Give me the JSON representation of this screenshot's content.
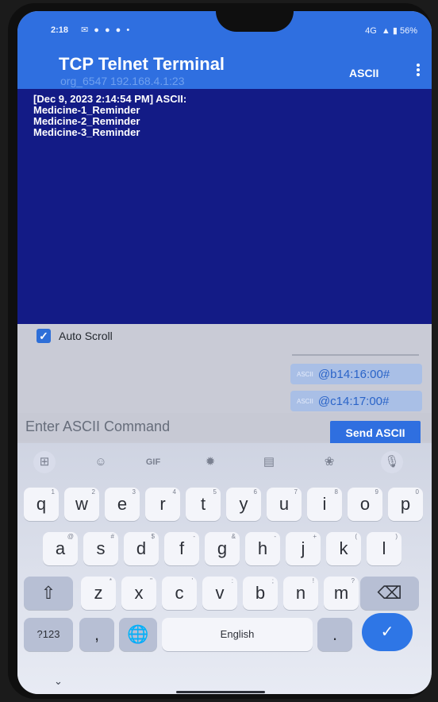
{
  "status_bar": {
    "time": "2:18",
    "notification_icons": [
      "message-icon",
      "person-icon",
      "person-icon",
      "person-icon",
      "dot-icon"
    ],
    "network": "4G",
    "battery": "56%"
  },
  "app_bar": {
    "title": "TCP Telnet Terminal",
    "subtitle": "org_6547 192.168.4.1:23",
    "mode_label": "ASCII",
    "more_icon": "more-vert-icon"
  },
  "terminal": {
    "lines": [
      "[Dec 9, 2023 2:14:54 PM] ASCII:",
      "Medicine-1_Reminder",
      "Medicine-2_Reminder",
      "Medicine-3_Reminder"
    ]
  },
  "controls": {
    "auto_scroll_label": "Auto Scroll",
    "auto_scroll_checked": true
  },
  "history": [
    {
      "prefix": "ASCII",
      "value": "@b14:16:00#"
    },
    {
      "prefix": "ASCII",
      "value": "@c14:17:00#"
    }
  ],
  "input": {
    "placeholder": "Enter ASCII Command",
    "value": "",
    "send_label": "Send ASCII"
  },
  "keyboard": {
    "toolbar": [
      "apps-icon",
      "sticker-icon",
      "GIF",
      "settings-icon",
      "translate-icon",
      "palette-icon",
      "mic-icon"
    ],
    "row1": [
      {
        "key": "q",
        "hint": "1"
      },
      {
        "key": "w",
        "hint": "2"
      },
      {
        "key": "e",
        "hint": "3"
      },
      {
        "key": "r",
        "hint": "4"
      },
      {
        "key": "t",
        "hint": "5"
      },
      {
        "key": "y",
        "hint": "6"
      },
      {
        "key": "u",
        "hint": "7"
      },
      {
        "key": "i",
        "hint": "8"
      },
      {
        "key": "o",
        "hint": "9"
      },
      {
        "key": "p",
        "hint": "0"
      }
    ],
    "row2": [
      {
        "key": "a",
        "hint": "@"
      },
      {
        "key": "s",
        "hint": "#"
      },
      {
        "key": "d",
        "hint": "$"
      },
      {
        "key": "f",
        "hint": "-"
      },
      {
        "key": "g",
        "hint": "&"
      },
      {
        "key": "h",
        "hint": "-"
      },
      {
        "key": "j",
        "hint": "+"
      },
      {
        "key": "k",
        "hint": "("
      },
      {
        "key": "l",
        "hint": ")"
      }
    ],
    "row3": [
      {
        "key": "z",
        "hint": "*"
      },
      {
        "key": "x",
        "hint": "\""
      },
      {
        "key": "c",
        "hint": "'"
      },
      {
        "key": "v",
        "hint": ":"
      },
      {
        "key": "b",
        "hint": ";"
      },
      {
        "key": "n",
        "hint": "!"
      },
      {
        "key": "m",
        "hint": "?"
      }
    ],
    "symbols_label": "?123",
    "comma_label": ",",
    "space_label": "English",
    "period_label": ".",
    "shift_icon": "shift-icon",
    "backspace_icon": "backspace-icon",
    "globe_icon": "globe-icon",
    "enter_icon": "check-icon"
  },
  "colors": {
    "app_bar": "#2f6fe0",
    "terminal_bg": "#131b86",
    "accent": "#2e76e6"
  }
}
